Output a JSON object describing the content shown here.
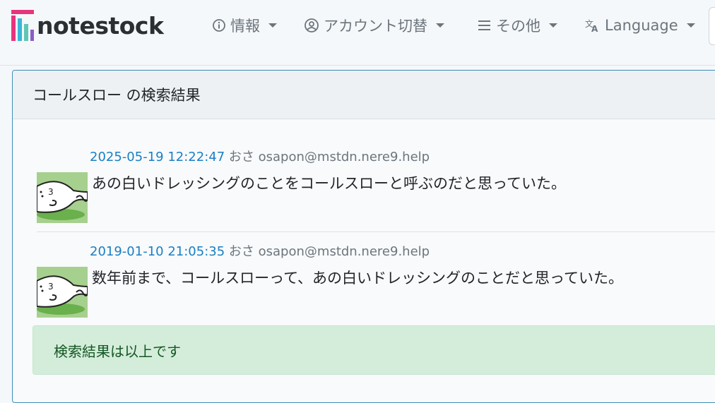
{
  "brand": {
    "name": "notestock"
  },
  "nav": {
    "items": [
      {
        "label": "情報",
        "icon": "info-circle-icon"
      },
      {
        "label": "アカウント切替",
        "icon": "user-switch-icon"
      },
      {
        "label": "その他",
        "icon": "hamburger-menu-icon"
      },
      {
        "label": "Language",
        "icon": "translate-icon"
      }
    ]
  },
  "search": {
    "title": "コールスロー の検索結果",
    "results": [
      {
        "timestamp": "2025-05-19 12:22:47",
        "display_name": "おさ",
        "handle": "osapon@mstdn.nere9.help",
        "text": "あの白いドレッシングのことをコールスローと呼ぶのだと思っていた。"
      },
      {
        "timestamp": "2019-01-10 21:05:35",
        "display_name": "おさ",
        "handle": "osapon@mstdn.nere9.help",
        "text": "数年前まで、コールスローって、あの白いドレッシングのことだと思っていた。"
      }
    ],
    "end_message": "検索結果は以上です"
  },
  "colors": {
    "link": "#1a7fc4",
    "card_border": "#3d8fb7",
    "alert_bg": "#d4edda",
    "alert_text": "#155724",
    "avatar_bg": "#a6d08e"
  }
}
